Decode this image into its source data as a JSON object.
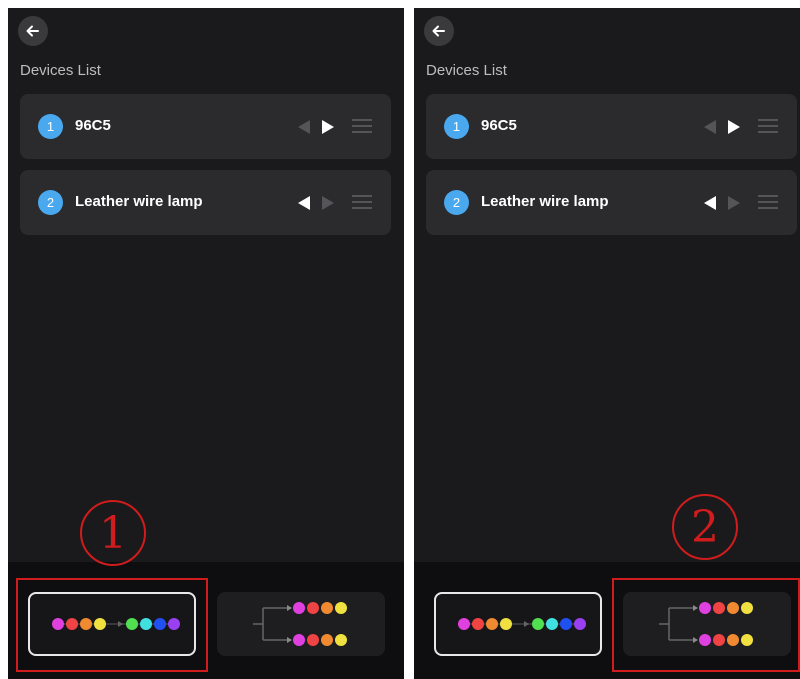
{
  "panels": [
    {
      "section_title": "Devices List",
      "callout": "1",
      "selected_mode": "serial",
      "devices": [
        {
          "number": "1",
          "name": "96C5",
          "active_direction": "right"
        },
        {
          "number": "2",
          "name": "Leather wire lamp",
          "active_direction": "left"
        }
      ]
    },
    {
      "section_title": "Devices List",
      "callout": "2",
      "selected_mode": "parallel",
      "devices": [
        {
          "number": "1",
          "name": "96C5",
          "active_direction": "right"
        },
        {
          "number": "2",
          "name": "Leather wire lamp",
          "active_direction": "left"
        }
      ]
    }
  ],
  "icons": {
    "back": "back-arrow-icon",
    "menu": "drag-handle-icon",
    "direction_left": "triangle-left-icon",
    "direction_right": "triangle-right-icon"
  },
  "colors": {
    "badge": "#4aa8ee",
    "highlight": "#d01c1c",
    "serial_dots": [
      "#e040e0",
      "#f04444",
      "#f08a30",
      "#f0e040",
      "#50e050",
      "#40e0e0",
      "#2050f0",
      "#9a40f0"
    ],
    "parallel_dots": [
      "#e040e0",
      "#f04444",
      "#f08a30",
      "#f0e040"
    ]
  }
}
